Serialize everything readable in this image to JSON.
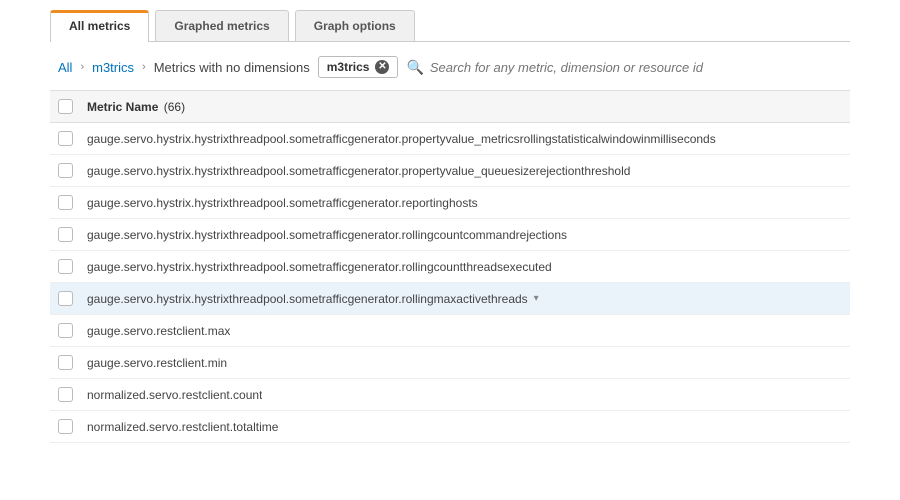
{
  "tabs": {
    "items": [
      {
        "label": "All metrics",
        "active": true
      },
      {
        "label": "Graphed metrics",
        "active": false
      },
      {
        "label": "Graph options",
        "active": false
      }
    ]
  },
  "breadcrumb": {
    "all": "All",
    "namespace": "m3trics",
    "current": "Metrics with no dimensions"
  },
  "filter_chip": {
    "label": "m3trics"
  },
  "search": {
    "placeholder": "Search for any metric, dimension or resource id"
  },
  "table": {
    "header_label": "Metric Name",
    "count_label": "(66)",
    "rows": [
      {
        "name": "gauge.servo.hystrix.hystrixthreadpool.sometrafficgenerator.propertyvalue_metricsrollingstatisticalwindowinmilliseconds",
        "selected": false
      },
      {
        "name": "gauge.servo.hystrix.hystrixthreadpool.sometrafficgenerator.propertyvalue_queuesizerejectionthreshold",
        "selected": false
      },
      {
        "name": "gauge.servo.hystrix.hystrixthreadpool.sometrafficgenerator.reportinghosts",
        "selected": false
      },
      {
        "name": "gauge.servo.hystrix.hystrixthreadpool.sometrafficgenerator.rollingcountcommandrejections",
        "selected": false
      },
      {
        "name": "gauge.servo.hystrix.hystrixthreadpool.sometrafficgenerator.rollingcountthreadsexecuted",
        "selected": false
      },
      {
        "name": "gauge.servo.hystrix.hystrixthreadpool.sometrafficgenerator.rollingmaxactivethreads",
        "selected": true
      },
      {
        "name": "gauge.servo.restclient.max",
        "selected": false
      },
      {
        "name": "gauge.servo.restclient.min",
        "selected": false
      },
      {
        "name": "normalized.servo.restclient.count",
        "selected": false
      },
      {
        "name": "normalized.servo.restclient.totaltime",
        "selected": false
      }
    ]
  }
}
